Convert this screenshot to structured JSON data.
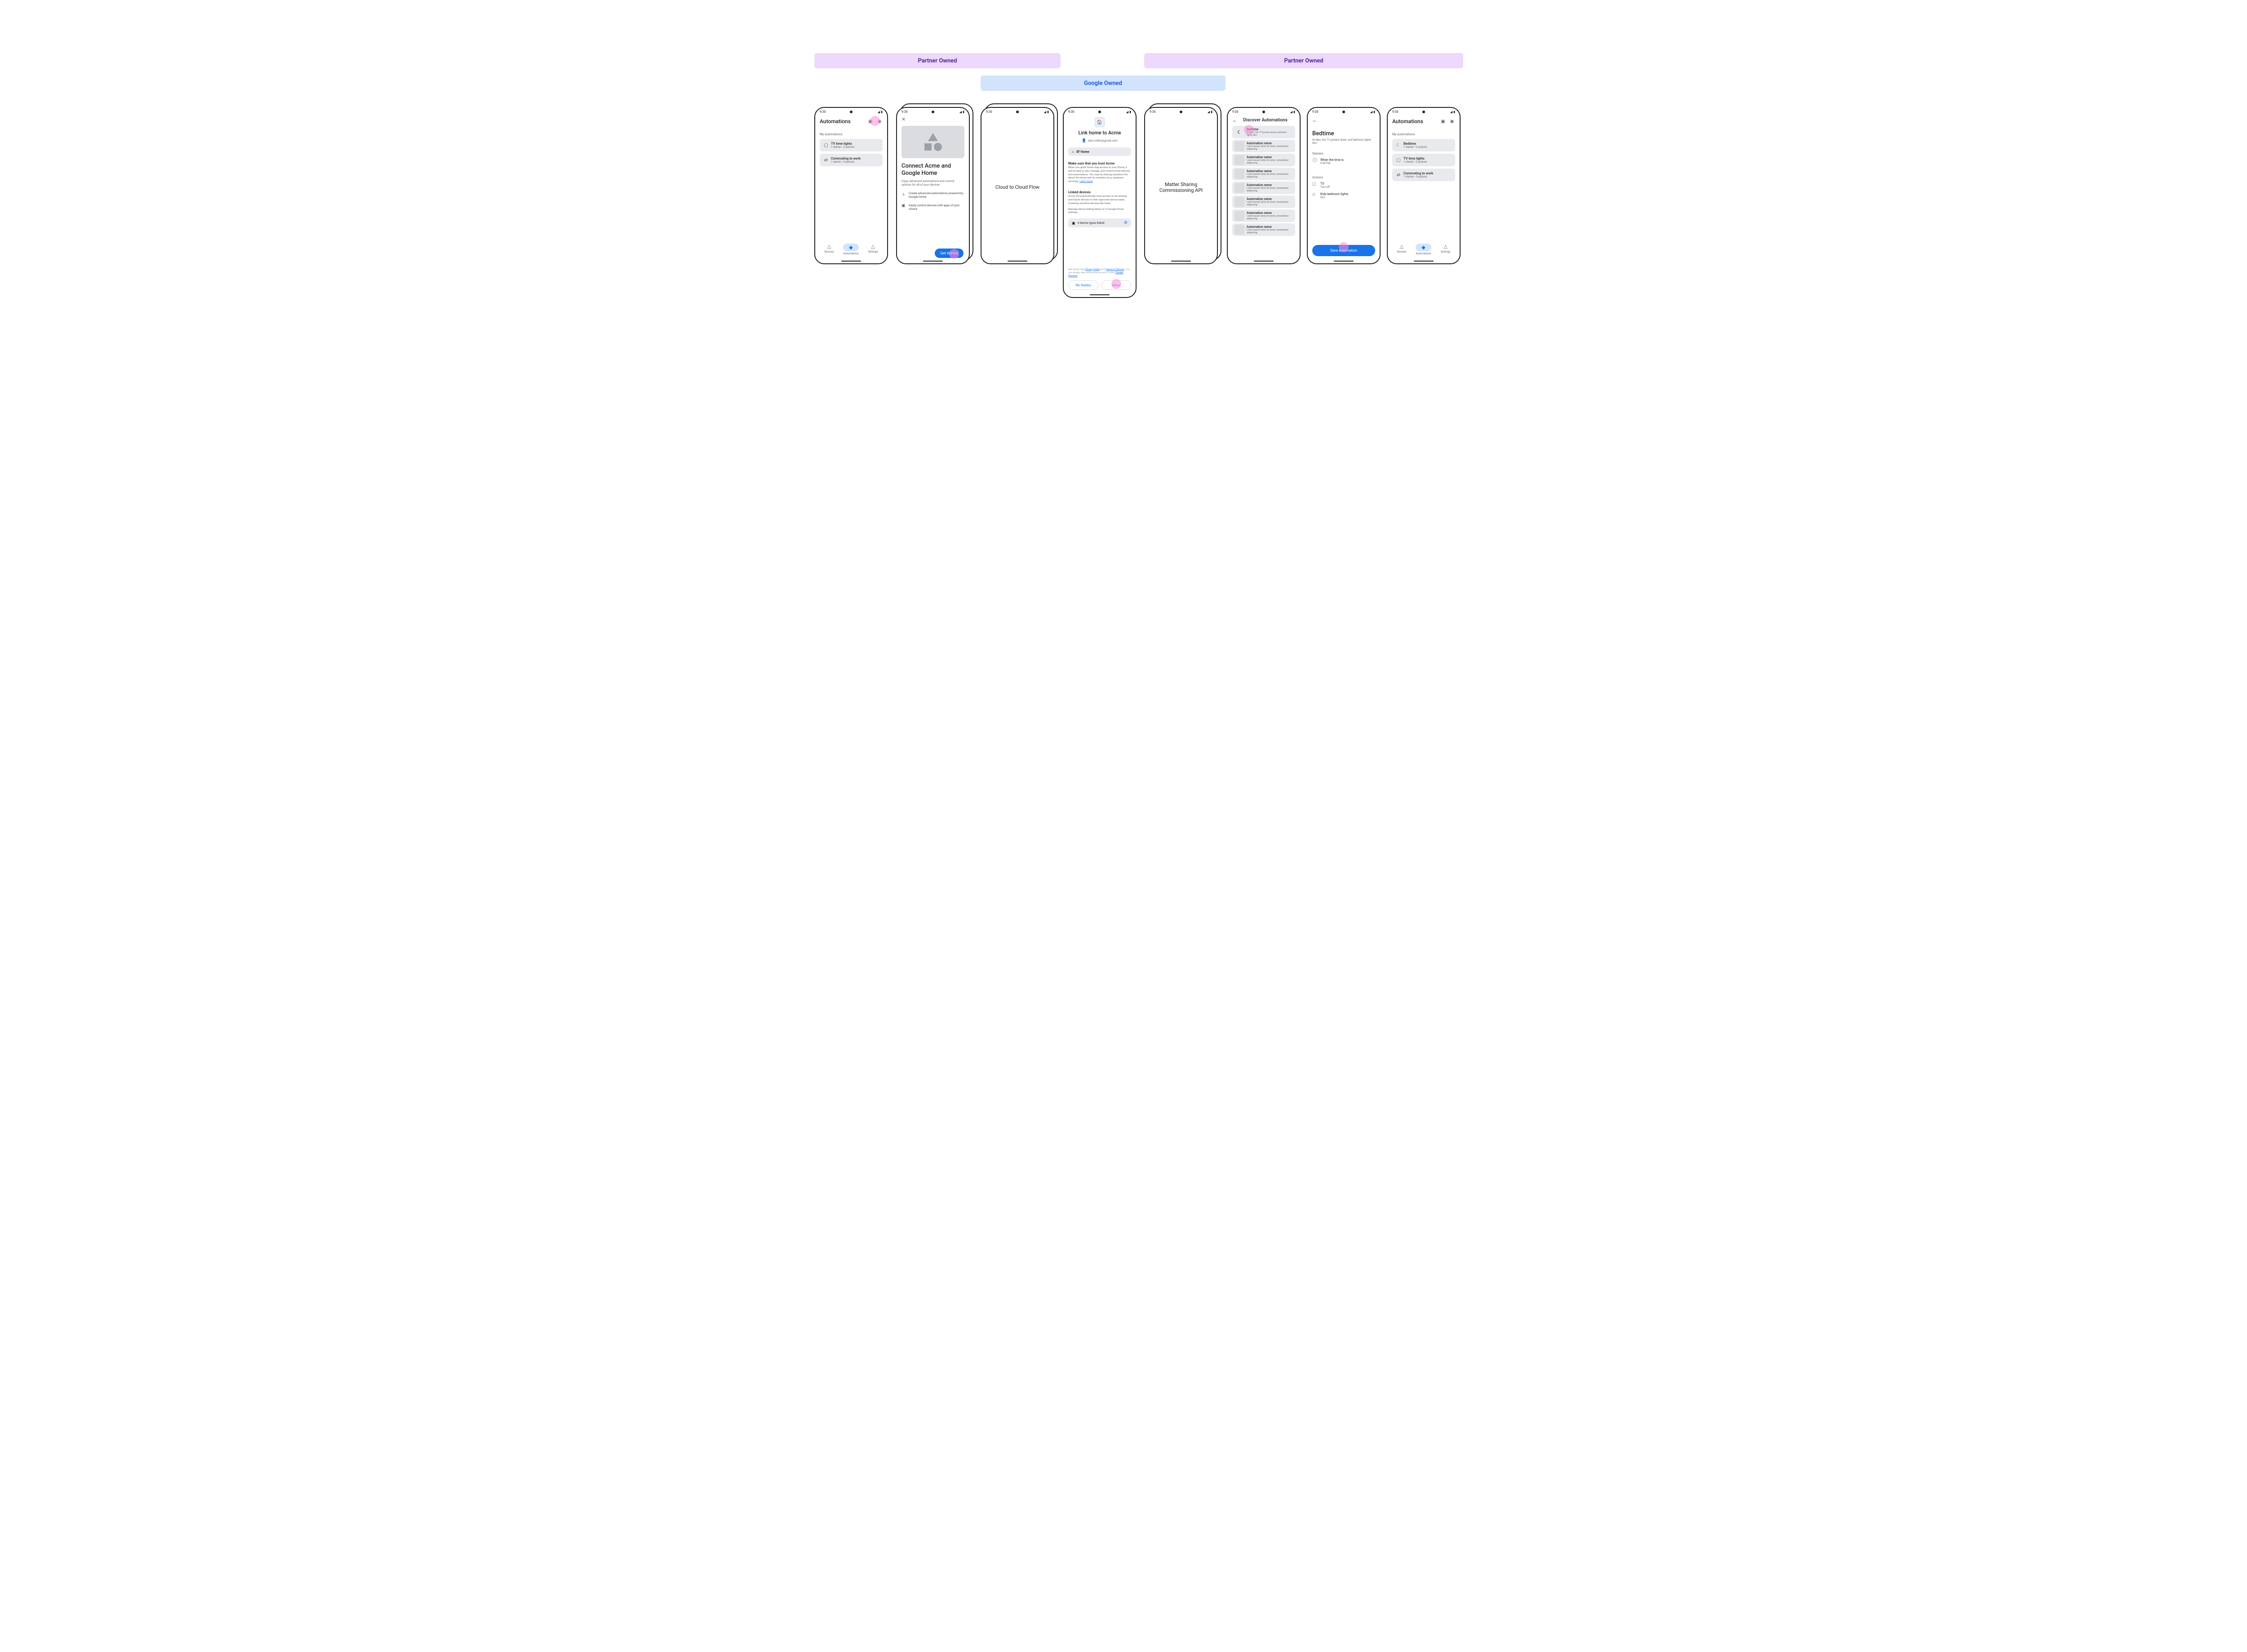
{
  "banners": {
    "left": "Partner Owned",
    "right": "Partner Owned",
    "mid": "Google Owned"
  },
  "status_time": "9:30",
  "screen1": {
    "title": "Automations",
    "section": "My automations",
    "cards": [
      {
        "icon": "▢",
        "t": "TV time lights",
        "s": "1 starter • 2 actions"
      },
      {
        "icon": "⇄",
        "t": "Commuting to work",
        "s": "1 starter • 3 actions"
      }
    ],
    "nav": {
      "devices": "Devices",
      "automations": "Automations",
      "settings": "Settings"
    }
  },
  "screen2": {
    "title": "Connect Acme and Google Home",
    "body": "Enjoy advanced automations and control options for all of your devices",
    "feat1": "Create advanced automations powered by Google Home",
    "feat2": "Easily control devices with apps of your choice",
    "cta": "Get started"
  },
  "screen3": {
    "text": "Cloud to Cloud Flow"
  },
  "screen4": {
    "title": "Link home to Acme",
    "email": "alex.miller@gmail.com",
    "home": "SF Home",
    "trust_h": "Make sure that you trust Acme",
    "trust_p_a": "When you grant Smart App access to your Home, it will be able to  see, manage, and control those devices and automations. You may be sharing sensitive info about the home and its members (e.g. presence sensing). ",
    "trust_link": "Learn more",
    "linked_h": "Linked devices",
    "linked_p": "Acme will automatically have access to all existing and future devices in their approved device types, including sensitive devices like locks.",
    "linked_p2": "Manage device linking below or in Google Home settings.",
    "device_count": "4 device types linked",
    "legal_a": "See Smart App ",
    "legal_pp": "Privacy Policy",
    "legal_and": " and ",
    "legal_tos": "Terms of Service",
    "legal_b": ". You can always see and remove access in your ",
    "legal_ga": "Google Account",
    "no": "No thanks",
    "allow": "Allow"
  },
  "screen5": {
    "text1": "Matter Sharing",
    "text2": "Commissioning API"
  },
  "screen6": {
    "title": "Discover Automations",
    "first": {
      "t": "Bedtime",
      "s": "At 9pm, the TV powers down, bedroom lights dim."
    },
    "generic": {
      "t": "Automation name",
      "s": "Lorem ipsum dolor sit amet, consectetur adipiscing."
    }
  },
  "screen7": {
    "title": "Bedtime",
    "sub": "At 9pm, the TV powers down, and bedroom lights dim.",
    "starters_h": "Starters",
    "starter": {
      "l1": "When the time is",
      "l2": "9:00 PM"
    },
    "actions_h": "Actions",
    "a1": {
      "l1": "TV",
      "l2": "Turn off"
    },
    "a2": {
      "l1": "Kids bedroom lights",
      "l2": "Dim"
    },
    "save": "Save automation"
  },
  "screen8": {
    "title": "Automations",
    "section": "My automations",
    "cards": [
      {
        "icon": "☾",
        "t": "Bedtime",
        "s": "1 starter • 2 actions"
      },
      {
        "icon": "▢",
        "t": "TV time lights",
        "s": "1 starter • 2 actions"
      },
      {
        "icon": "⇄",
        "t": "Commuting to work",
        "s": "1 starter • 3 actions"
      }
    ]
  }
}
